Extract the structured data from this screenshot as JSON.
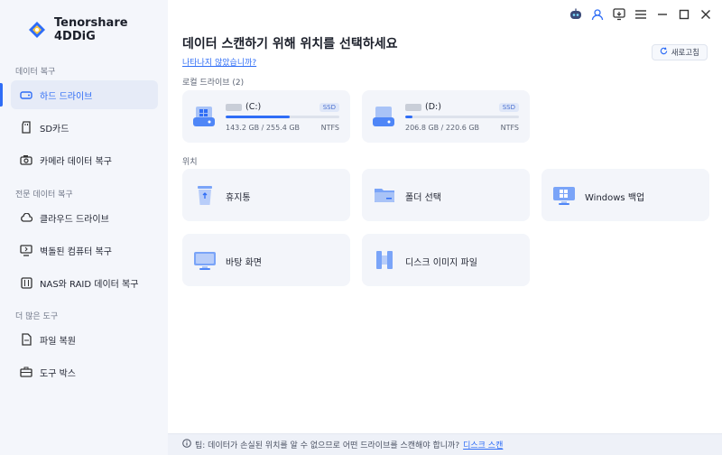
{
  "app": {
    "name": "Tenorshare 4DDiG"
  },
  "sidebar": {
    "sections": [
      {
        "label": "데이터 복구"
      },
      {
        "label": "전문 데이터 복구"
      },
      {
        "label": "더 많은 도구"
      }
    ],
    "items": [
      {
        "label": "하드 드라이브",
        "icon": "hard-drive-icon"
      },
      {
        "label": "SD카드",
        "icon": "sd-card-icon"
      },
      {
        "label": "카메라 데이터 복구",
        "icon": "camera-icon"
      },
      {
        "label": "클라우드 드라이브",
        "icon": "cloud-icon"
      },
      {
        "label": "벽돌된 컴퓨터 복구",
        "icon": "broken-computer-icon"
      },
      {
        "label": "NAS와 RAID 데이터 복구",
        "icon": "nas-icon"
      },
      {
        "label": "파일 복원",
        "icon": "file-restore-icon"
      },
      {
        "label": "도구 박스",
        "icon": "toolbox-icon"
      }
    ]
  },
  "main": {
    "title": "데이터 스캔하기 위해 위치를 선택하세요",
    "help_link": "나타나지 않았습니까?",
    "refresh_label": "새로고침",
    "local_drives_label": "로컬 드라이브 (2)",
    "locations_label": "위치",
    "drives": [
      {
        "name": "(C:)",
        "type": "SSD",
        "size": "143.2 GB / 255.4 GB",
        "fs": "NTFS",
        "used_fraction": 0.56
      },
      {
        "name": "(D:)",
        "type": "SSD",
        "size": "206.8 GB / 220.6 GB",
        "fs": "NTFS",
        "used_fraction": 0.06
      }
    ],
    "locations": [
      {
        "label": "휴지통",
        "icon": "recycle-bin-icon"
      },
      {
        "label": "폴더 선택",
        "icon": "folder-icon"
      },
      {
        "label": "Windows 백업",
        "icon": "windows-backup-icon"
      },
      {
        "label": "바탕 화면",
        "icon": "desktop-icon"
      },
      {
        "label": "디스크 이미지 파일",
        "icon": "disk-image-icon"
      }
    ]
  },
  "footer": {
    "tip": "팁: 데이터가 손실된 위치를 알 수 없으므로 어떤 드라이브를 스캔해야 합니까?",
    "link": "디스크 스캔"
  },
  "colors": {
    "accent": "#2f6df6",
    "sidebar_bg": "#f4f6fb",
    "card_bg": "#f3f5fa"
  }
}
